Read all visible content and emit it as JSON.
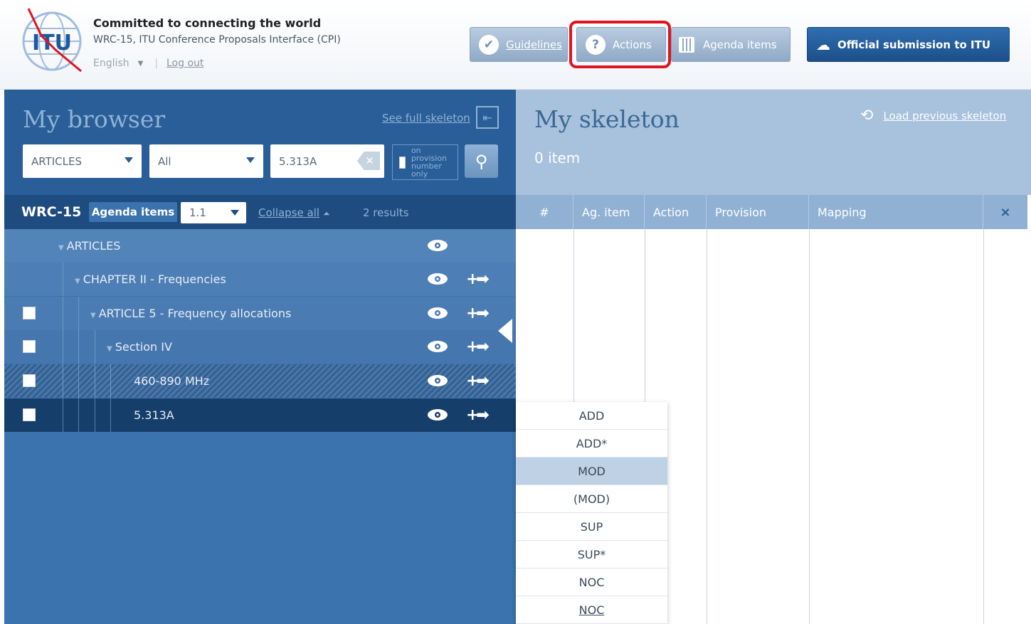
{
  "header": {
    "tagline": "Committed to connecting the world",
    "subtitle": "WRC-15, ITU Conference Proposals Interface (CPI)",
    "language": "English",
    "logout": "Log out",
    "buttons": {
      "guidelines": "Guidelines",
      "actions": "Actions",
      "agenda_items": "Agenda items",
      "official": "Official submission to ITU"
    }
  },
  "browser": {
    "title": "My browser",
    "see_full": "See full skeleton",
    "filter1": "ARTICLES",
    "filter2": "All",
    "search_value": "5.313A",
    "provision_only": "on provision number only",
    "wrc_label": "WRC-15",
    "agenda_chip": "Agenda items",
    "agenda_value": "1.1",
    "collapse_all": "Collapse all",
    "results": "2 results",
    "tree": [
      {
        "label": "ARTICLES"
      },
      {
        "label": "CHAPTER II - Frequencies"
      },
      {
        "label": "ARTICLE 5 - Frequency allocations"
      },
      {
        "label": "Section IV"
      },
      {
        "label": "460-890 MHz"
      },
      {
        "label": "5.313A"
      }
    ]
  },
  "skeleton": {
    "title": "My skeleton",
    "count": "0 item",
    "load_previous": "Load previous skeleton",
    "columns": {
      "hash": "#",
      "ag_item": "Ag. item",
      "action": "Action",
      "provision": "Provision",
      "mapping": "Mapping",
      "close": "×"
    }
  },
  "actions_menu": [
    "ADD",
    "ADD*",
    "MOD",
    "(MOD)",
    "SUP",
    "SUP*",
    "NOC",
    "NOC"
  ],
  "actions_menu_selected": "MOD",
  "colors": {
    "dark_blue": "#1e4b80",
    "panel_blue": "#3b73ae",
    "highlight_red": "#e0141e"
  }
}
